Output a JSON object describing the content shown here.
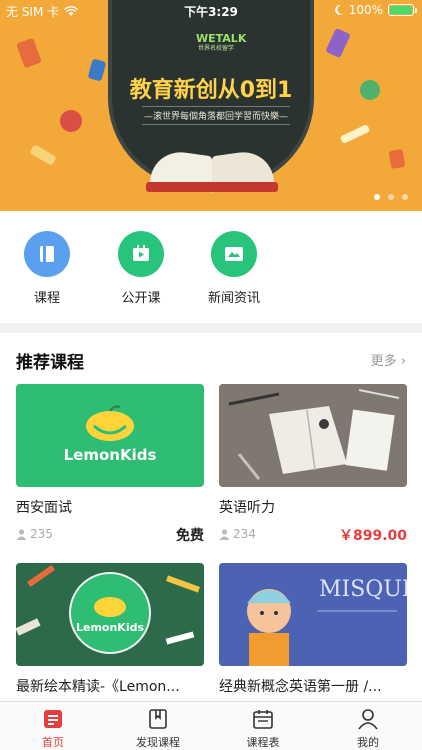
{
  "status_bar": {
    "carrier": "无 SIM 卡",
    "time": "下午3:29",
    "battery": "100%"
  },
  "banner": {
    "logo_text": "WETALK",
    "logo_sub": "世界名校留学",
    "headline": "教育新创从0到1",
    "subline": "—滚世界每個角落都回学習而快樂—",
    "page_count": 3,
    "active_page": 0
  },
  "quick_menu": [
    {
      "label": "课程",
      "icon": "book-icon",
      "color": "#5aa0ee"
    },
    {
      "label": "公开课",
      "icon": "video-icon",
      "color": "#28c47c"
    },
    {
      "label": "新闻资讯",
      "icon": "news-icon",
      "color": "#28c47c"
    }
  ],
  "section": {
    "title": "推荐课程",
    "more": "更多"
  },
  "courses": [
    {
      "name": "西安面试",
      "views": "235",
      "price": "免费",
      "price_style": "free",
      "thumb_text": "LemonKids"
    },
    {
      "name": "英语听力",
      "views": "234",
      "price": "￥899.00",
      "price_style": "paid",
      "thumb_text": ""
    },
    {
      "name": "最新绘本精读-《Lemon...",
      "views": "",
      "price": "",
      "price_style": "free",
      "thumb_text": "LemonKids"
    },
    {
      "name": "经典新概念英语第一册 /...",
      "views": "",
      "price": "",
      "price_style": "free",
      "thumb_text": "MISQUE"
    }
  ],
  "tabbar": [
    {
      "label": "首页",
      "icon": "home-icon",
      "active": true
    },
    {
      "label": "发现课程",
      "icon": "bookmark-icon",
      "active": false
    },
    {
      "label": "课程表",
      "icon": "calendar-icon",
      "active": false
    },
    {
      "label": "我的",
      "icon": "profile-icon",
      "active": false
    }
  ],
  "colors": {
    "accent": "#e43e3e",
    "banner_bg": "#f3a83a",
    "green": "#28c47c",
    "blue": "#5aa0ee"
  }
}
